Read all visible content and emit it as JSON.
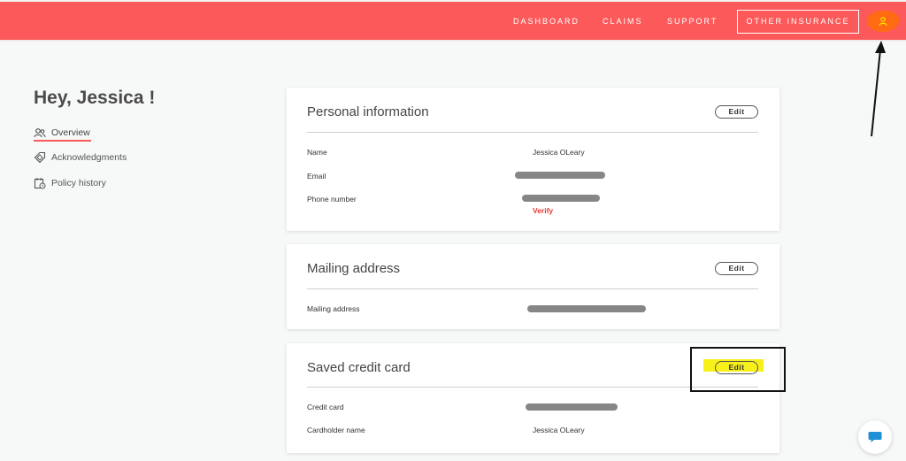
{
  "nav": {
    "dashboard": "DASHBOARD",
    "claims": "CLAIMS",
    "support": "SUPPORT",
    "other_insurance": "OTHER INSURANCE",
    "user_icon": "user-icon"
  },
  "sidebar": {
    "greeting": "Hey, Jessica !",
    "items": [
      {
        "label": "Overview",
        "icon": "people-icon",
        "active": true
      },
      {
        "label": "Acknowledgments",
        "icon": "tag-icon"
      },
      {
        "label": "Policy history",
        "icon": "calendar-clock-icon"
      }
    ]
  },
  "personal": {
    "title": "Personal information",
    "edit_label": "Edit",
    "name_label": "Name",
    "name_value": "Jessica OLeary",
    "email_label": "Email",
    "phone_label": "Phone number",
    "verify_label": "Verify"
  },
  "mailing": {
    "title": "Mailing address",
    "edit_label": "Edit",
    "address_label": "Mailing address"
  },
  "credit": {
    "title": "Saved credit card",
    "edit_label": "Edit",
    "card_label": "Credit card",
    "holder_label": "Cardholder name",
    "holder_value": "Jessica OLeary"
  },
  "colors": {
    "brand": "#fc5a5a",
    "user_badge": "#ff6a12",
    "verify": "#e53935",
    "highlight": "#f8f01a",
    "chat": "#1f8fd6"
  }
}
